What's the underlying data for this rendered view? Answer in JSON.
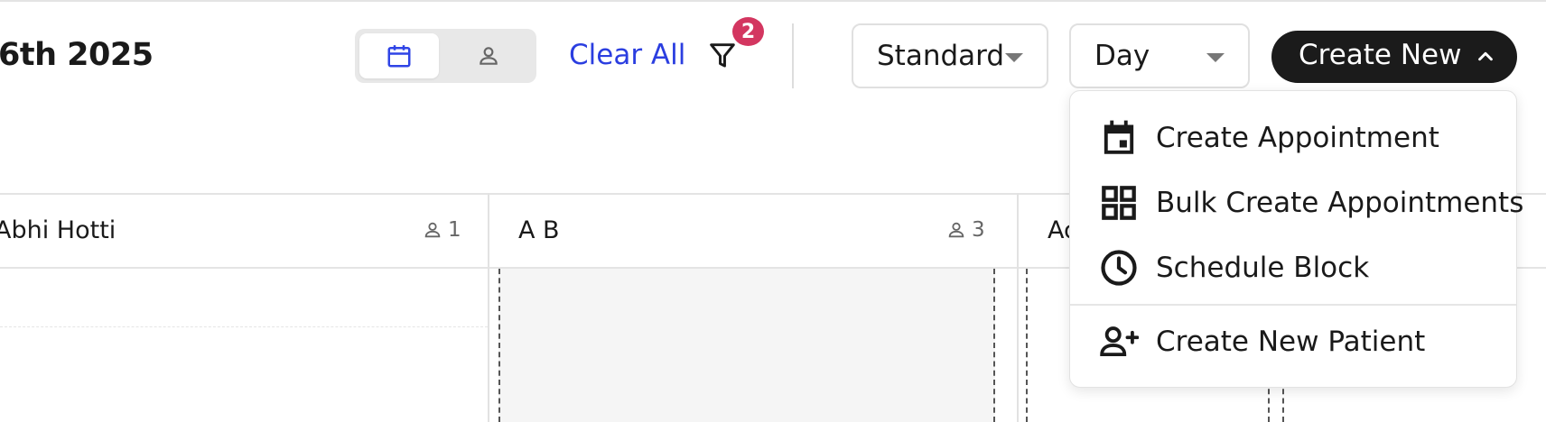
{
  "header": {
    "date_title": "6th 2025",
    "clear_all_label": "Clear All",
    "filter_badge_count": "2"
  },
  "view_toggle": {
    "options": [
      {
        "icon": "calendar-icon",
        "active": true
      },
      {
        "icon": "person-icon",
        "active": false
      }
    ]
  },
  "dropdowns": {
    "view_type": "Standard",
    "range": "Day"
  },
  "create_new": {
    "label": "Create New",
    "menu": [
      {
        "label": "Create Appointment",
        "icon": "calendar-event-icon"
      },
      {
        "label": "Bulk Create Appointments",
        "icon": "grid-icon"
      },
      {
        "label": "Schedule Block",
        "icon": "clock-icon"
      },
      {
        "label": "Create New Patient",
        "icon": "add-person-icon"
      }
    ]
  },
  "columns": [
    {
      "name": "Abhi Hotti",
      "count": "1"
    },
    {
      "name": "A B",
      "count": "3"
    },
    {
      "name": "Ac",
      "count": ""
    }
  ],
  "colors": {
    "accent_link": "#2b3ee0",
    "badge": "#d33660",
    "primary_button": "#1b1b1b",
    "active_toggle_icon": "#2f44e6"
  }
}
